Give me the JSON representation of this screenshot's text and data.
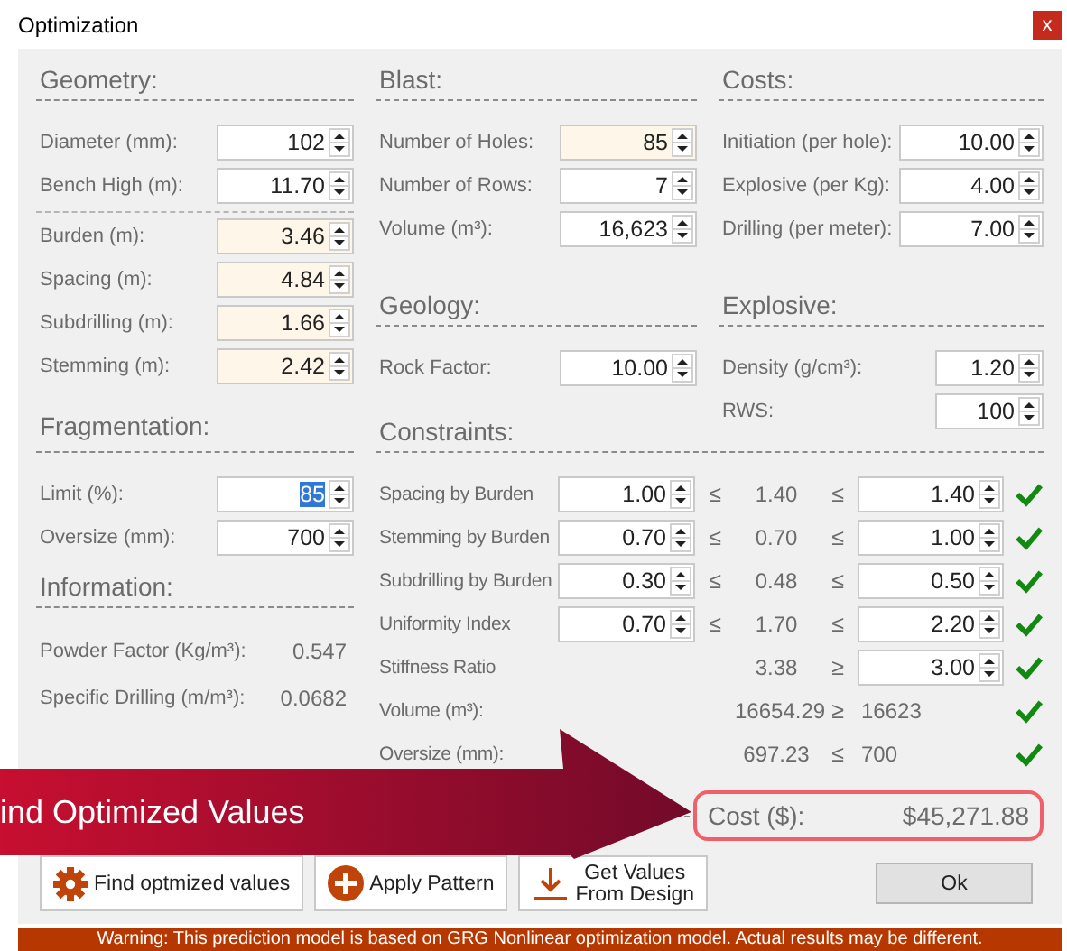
{
  "window": {
    "title": "Optimization",
    "close": "x"
  },
  "geometry": {
    "title": "Geometry:",
    "groups": [
      [
        {
          "label": "Diameter (mm):",
          "value": "102",
          "computed": false
        },
        {
          "label": "Bench High (m):",
          "value": "11.70",
          "computed": false
        }
      ],
      [
        {
          "label": "Burden (m):",
          "value": "3.46",
          "computed": true
        },
        {
          "label": "Spacing  (m):",
          "value": "4.84",
          "computed": true
        },
        {
          "label": "Subdrilling (m):",
          "value": "1.66",
          "computed": true
        },
        {
          "label": "Stemming (m):",
          "value": "2.42",
          "computed": true
        }
      ]
    ]
  },
  "blast": {
    "title": "Blast:",
    "fields": [
      {
        "label": "Number of Holes:",
        "value": "85",
        "computed": true
      },
      {
        "label": "Number of Rows:",
        "value": "7",
        "computed": false
      },
      {
        "label": "Volume (m³):",
        "value": "16,623",
        "computed": false
      }
    ]
  },
  "costs": {
    "title": "Costs:",
    "fields": [
      {
        "label": "Initiation (per hole):",
        "value": "10.00",
        "computed": false
      },
      {
        "label": "Explosive (per Kg):",
        "value": "4.00",
        "computed": false
      },
      {
        "label": "Drilling (per meter):",
        "value": "7.00",
        "computed": false
      }
    ]
  },
  "geology": {
    "title": "Geology:",
    "fields": [
      {
        "label": "Rock Factor:",
        "value": "10.00",
        "computed": false
      }
    ]
  },
  "explosive": {
    "title": "Explosive:",
    "fields": [
      {
        "label": "Density (g/cm³):",
        "value": "1.20",
        "computed": false
      },
      {
        "label": "RWS:",
        "value": "100",
        "computed": false
      }
    ]
  },
  "fragmentation": {
    "title": "Fragmentation:",
    "fields": [
      {
        "label": "Limit (%):",
        "value": "85",
        "computed": false,
        "text_selected": true
      },
      {
        "label": "Oversize (mm):",
        "value": "700",
        "computed": false,
        "text_selected": false
      }
    ]
  },
  "information": {
    "title": "Information:",
    "items": [
      {
        "label": "Powder Factor (Kg/m³):",
        "value": "0.547"
      },
      {
        "label": "Specific Drilling (m/m³):",
        "value": "0.0682"
      }
    ]
  },
  "constraints": {
    "title": "Constraints:",
    "rows": [
      {
        "kind": "range",
        "label": "Spacing by Burden",
        "min": "1.00",
        "sign1": "≤",
        "value": "1.40",
        "sign2": "≤",
        "max": "1.40",
        "met": true
      },
      {
        "kind": "range",
        "label": "Stemming by Burden",
        "min": "0.70",
        "sign1": "≤",
        "value": "0.70",
        "sign2": "≤",
        "max": "1.00",
        "met": true
      },
      {
        "kind": "range",
        "label": "Subdrilling by Burden",
        "min": "0.30",
        "sign1": "≤",
        "value": "0.48",
        "sign2": "≤",
        "max": "0.50",
        "met": true
      },
      {
        "kind": "range",
        "label": "Uniformity Index",
        "min": "0.70",
        "sign1": "≤",
        "value": "1.70",
        "sign2": "≤",
        "max": "2.20",
        "met": true
      },
      {
        "kind": "bound",
        "label": "Stiffness Ratio",
        "value": "3.38",
        "sign2": "≥",
        "max": "3.00",
        "met": true
      },
      {
        "kind": "fixed",
        "label": "Volume (m³):",
        "value": "16654.29",
        "sign2": "≥",
        "target": "16623",
        "met": true
      },
      {
        "kind": "fixed",
        "label": "Oversize (mm):",
        "value": "697.23",
        "sign2": "≤",
        "target": "700",
        "met": true
      }
    ]
  },
  "cost": {
    "label": "Cost ($):",
    "value": "$45,271.88"
  },
  "buttons": [
    {
      "kind": "optimize",
      "lines": [
        "Find optmized values"
      ]
    },
    {
      "kind": "apply",
      "lines": [
        "Apply Pattern"
      ]
    },
    {
      "kind": "import",
      "lines": [
        "Get Values",
        "From Design"
      ]
    },
    {
      "kind": "ok",
      "lines": [
        "Ok"
      ]
    }
  ],
  "callout": {
    "text": "ind Optimized Values"
  },
  "warning": "Warning: This prediction model is based on GRG Nonlinear optimization model. Actual results may be different."
}
